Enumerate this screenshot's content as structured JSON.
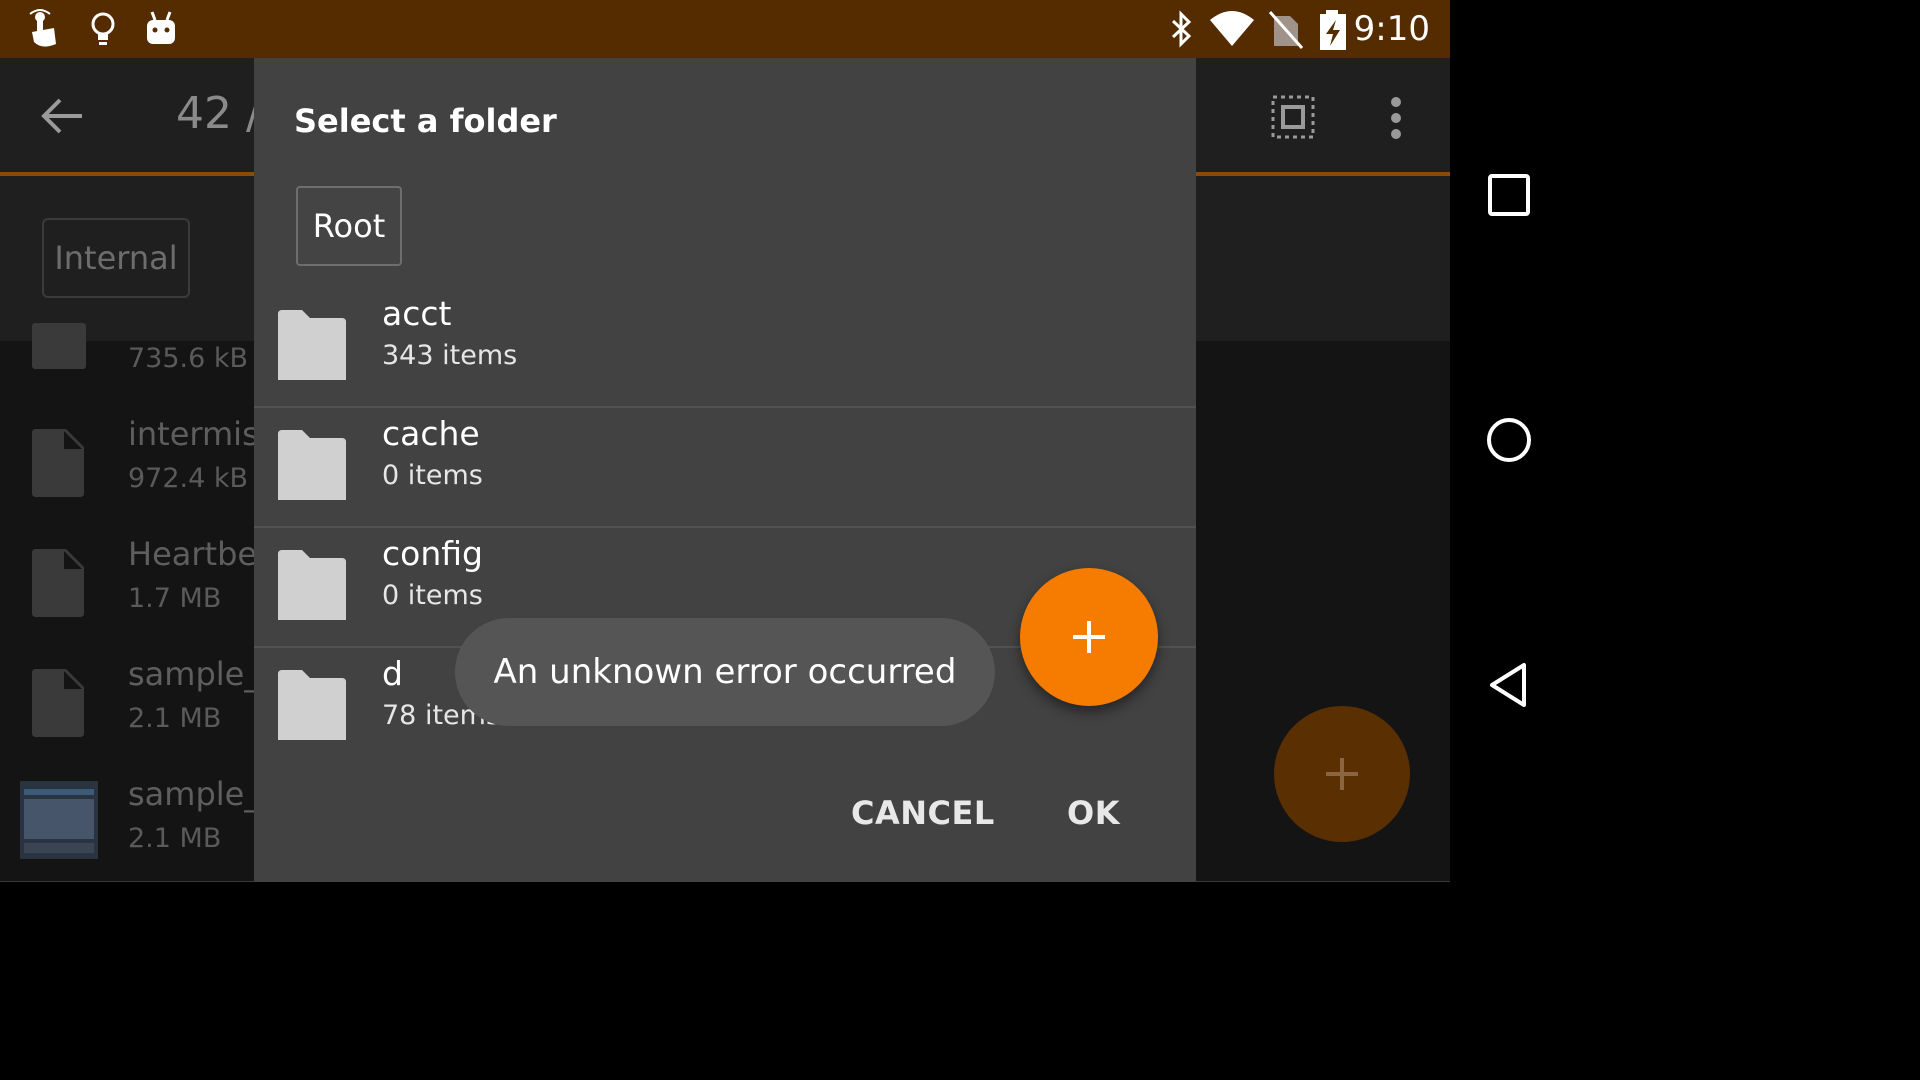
{
  "statusbar": {
    "time": "9:10",
    "left_icons": [
      "touch-icon",
      "lightbulb-icon",
      "android-icon"
    ],
    "right_icons": [
      "bluetooth-icon",
      "wifi-icon",
      "no-sim-icon",
      "battery-charging-icon"
    ],
    "background_color": "#542c00"
  },
  "app": {
    "title": "42 /",
    "storage_chip": "Internal",
    "accent_color": "#f57c00",
    "files": [
      {
        "name": "",
        "size": "735.6 kB",
        "icon": "folder-icon"
      },
      {
        "name": "intermis",
        "size": "972.4 kB",
        "icon": "file-icon"
      },
      {
        "name": "Heartbe",
        "size": "1.7 MB",
        "icon": "file-icon"
      },
      {
        "name": "sample_",
        "size": "2.1 MB",
        "icon": "file-icon"
      },
      {
        "name": "sample_",
        "size": "2.1 MB",
        "icon": "image-thumbnail-icon"
      }
    ]
  },
  "dialog": {
    "title": "Select a folder",
    "breadcrumb": "Root",
    "folders": [
      {
        "name": "acct",
        "count": "343 items"
      },
      {
        "name": "cache",
        "count": "0 items"
      },
      {
        "name": "config",
        "count": "0 items"
      },
      {
        "name": "d",
        "count": "78 items"
      }
    ],
    "cancel_label": "CANCEL",
    "ok_label": "OK",
    "fab_icon": "plus-icon"
  },
  "toast": {
    "message": "An unknown error occurred"
  },
  "navbar": {
    "buttons": [
      "recents-button",
      "home-button",
      "back-button"
    ]
  }
}
